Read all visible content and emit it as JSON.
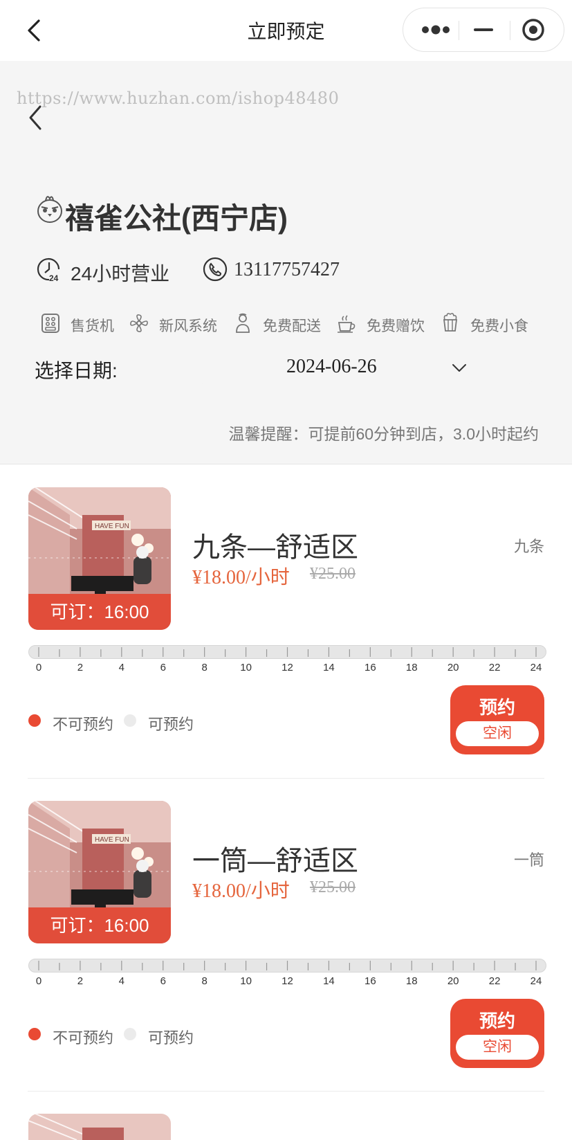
{
  "navbar": {
    "title": "立即预定"
  },
  "watermark": "https://www.huzhan.com/ishop48480",
  "store": {
    "name": "禧雀公社(西宁店)",
    "hours": "24小时营业",
    "phone": "13117757427",
    "facilities": [
      {
        "icon": "vending-machine-icon",
        "label": "售货机"
      },
      {
        "icon": "fan-icon",
        "label": "新风系统"
      },
      {
        "icon": "delivery-person-icon",
        "label": "免费配送"
      },
      {
        "icon": "coffee-cup-icon",
        "label": "免费赠饮"
      },
      {
        "icon": "popcorn-icon",
        "label": "免费小食"
      }
    ]
  },
  "date_picker": {
    "label": "选择日期:",
    "value": "2024-06-26"
  },
  "tip": "温馨提醒：可提前60分钟到店，3.0小时起约",
  "legend": {
    "unavailable": "不可预约",
    "available": "可预约"
  },
  "colors": {
    "accent": "#e94a33",
    "price": "#e5653d",
    "bg_header": "#f5f5f5"
  },
  "timeline_ticks": [
    "0",
    "2",
    "4",
    "6",
    "8",
    "10",
    "12",
    "14",
    "16",
    "18",
    "20",
    "22",
    "24"
  ],
  "rooms": [
    {
      "name": "九条—舒适区",
      "tag": "九条",
      "price": "¥18.00/小时",
      "original_price": "¥25.00",
      "available_from": "可订：16:00",
      "book_label": "预约",
      "status": "空闲"
    },
    {
      "name": "一筒—舒适区",
      "tag": "一筒",
      "price": "¥18.00/小时",
      "original_price": "¥25.00",
      "available_from": "可订：16:00",
      "book_label": "预约",
      "status": "空闲"
    }
  ]
}
